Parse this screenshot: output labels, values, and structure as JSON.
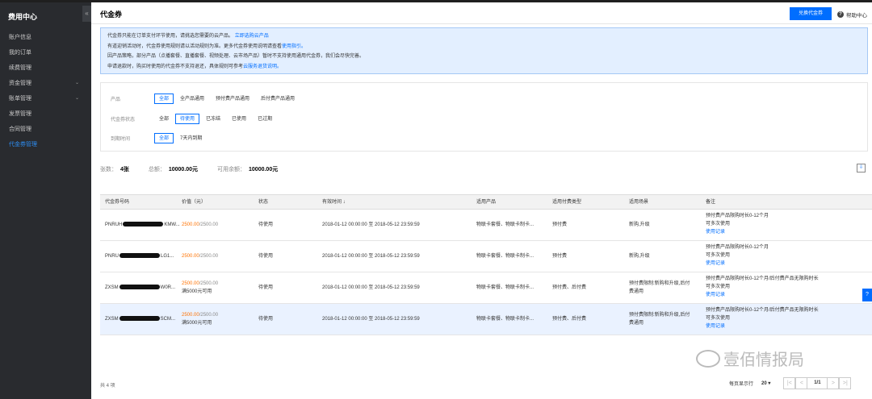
{
  "sidebar": {
    "title": "费用中心",
    "collapse_icon": "«",
    "items": [
      {
        "label": "账户信息"
      },
      {
        "label": "我的订单"
      },
      {
        "label": "续费管理"
      },
      {
        "label": "资金管理",
        "chevron": "⌄"
      },
      {
        "label": "账单管理",
        "chevron": "⌄"
      },
      {
        "label": "发票管理"
      },
      {
        "label": "合同管理"
      },
      {
        "label": "代金券管理"
      }
    ]
  },
  "header": {
    "title": "代金券",
    "exchange_label": "兑换代金券",
    "help_icon": "?",
    "help_label": "帮助中心"
  },
  "notice": {
    "line1": "代金券只能在订单支付环节使用，请挑选您需要的云产品。",
    "line1_link": "立即选购云产品",
    "line2": "有道迎销活动时，代金券使用规则请以活动规则为准。更多代金券使用说明请查看",
    "line2_link": "使用指引。",
    "line3": "因产品策略，部分产品（点播套餐、直播套餐、视频处理、云市场产品）暂时不支持使用通用代金券，我们会尽快完善。",
    "line4": "申请退款时，购买时使用的代金券不支持退还，具体规则可参考",
    "line4_link": "云服务退货说明。"
  },
  "filters": {
    "product": {
      "label": "产品",
      "options": [
        "全部",
        "全产品通用",
        "预付费产品通用",
        "后付费产品通用"
      ]
    },
    "status": {
      "label": "代金券状态",
      "options": [
        "全部",
        "待使用",
        "已冻结",
        "已使用",
        "已过期"
      ]
    },
    "expiry": {
      "label": "到期时间",
      "options": [
        "全部",
        "7天内到期"
      ]
    }
  },
  "summary": {
    "count_label": "张数：",
    "count_value": "4张",
    "total_label": "总额：",
    "total_value": "10000.00元",
    "available_label": "可用余额：",
    "available_value": "10000.00元"
  },
  "download_icon": "⇩",
  "table": {
    "columns": [
      "代金券号码",
      "价值（元）",
      "状态",
      "有效时间 ↓",
      "适用产品",
      "适用付费类型",
      "适用场景",
      "备注"
    ],
    "rows": [
      {
        "code_prefix": "PNRUH",
        "code_suffix": "KMW...",
        "value_remaining": "2500.00",
        "value_total": "/2500.00",
        "value_note": "",
        "status": "待使用",
        "time": "2018-01-12 00:00:00 至 2018-05-12 23:59:59",
        "products": "物联卡套餐、物联卡制卡...",
        "pay_type": "预付费",
        "scene1": "新购,升级",
        "scene2": "",
        "note1": "预付费产品限购时长0-12个月",
        "note2": "可多次使用",
        "note_link": "使用记录"
      },
      {
        "code_prefix": "PNRU",
        "code_suffix": "LG1...",
        "value_remaining": "2500.00",
        "value_total": "/2500.00",
        "value_note": "",
        "status": "待使用",
        "time": "2018-01-12 00:00:00 至 2018-05-12 23:59:59",
        "products": "物联卡套餐、物联卡制卡...",
        "pay_type": "预付费",
        "scene1": "新购,升级",
        "scene2": "",
        "note1": "预付费产品限购时长0-12个月",
        "note2": "可多次使用",
        "note_link": "使用记录"
      },
      {
        "code_prefix": "ZXSM",
        "code_suffix": "W0R...",
        "value_remaining": "2500.00",
        "value_total": "/2500.00",
        "value_note": "满5000元可用",
        "status": "待使用",
        "time": "2018-01-12 00:00:00 至 2018-05-12 23:59:59",
        "products": "物联卡套餐、物联卡制卡...",
        "pay_type": "预付费、后付费",
        "scene1": "预付费限制:新购和升级,后付",
        "scene2": "费通用",
        "note1": "预付费产品限购时长0-12个月/后付费产品无限购时长",
        "note2": "可多次使用",
        "note_link": "使用记录"
      },
      {
        "code_prefix": "ZXSM",
        "code_suffix": "SCM...",
        "value_remaining": "2500.00",
        "value_total": "/2500.00",
        "value_note": "满5000元可用",
        "status": "待使用",
        "time": "2018-01-12 00:00:00 至 2018-05-12 23:59:59",
        "products": "物联卡套餐、物联卡制卡...",
        "pay_type": "预付费、后付费",
        "scene1": "预付费限制:新购和升级,后付",
        "scene2": "费通用",
        "note1": "预付费产品限购时长0-12个月/后付费产品无限购时长",
        "note2": "可多次使用",
        "note_link": "使用记录"
      }
    ]
  },
  "footer": {
    "total": "共 4 项",
    "page_size_label": "每页显示行",
    "page_size_value": "20 ▾",
    "page": "1/1",
    "first": "|<",
    "prev": "<",
    "next": ">",
    "last": ">|"
  },
  "float_help": "?",
  "watermark": "壹佰情报局",
  "colors": {
    "accent": "#006eff",
    "sidebar_bg": "#292b2f",
    "value_orange": "#ff7200",
    "notice_bg": "#e3efff"
  }
}
